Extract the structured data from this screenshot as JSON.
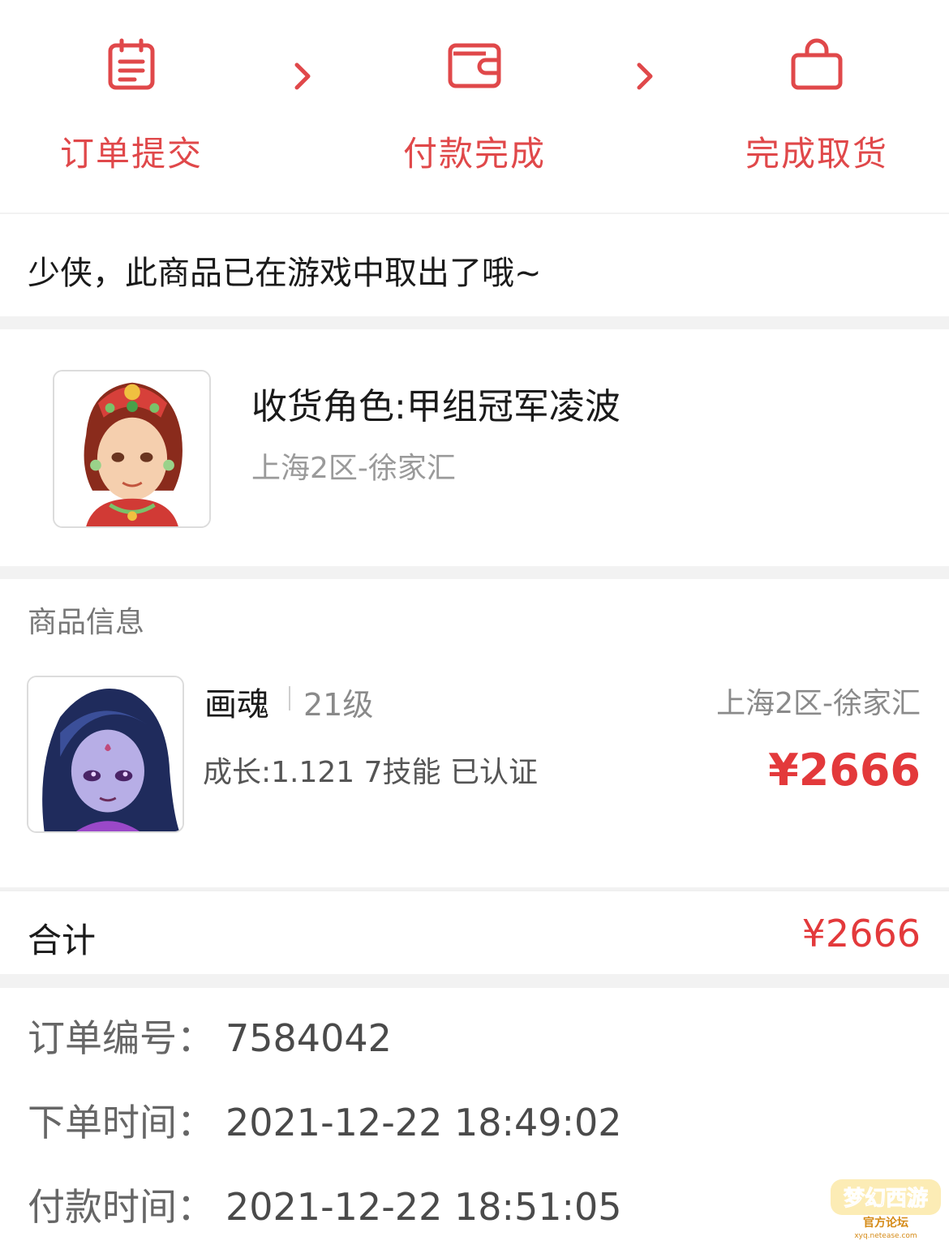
{
  "steps": [
    {
      "label": "订单提交",
      "icon": "clipboard-icon"
    },
    {
      "label": "付款完成",
      "icon": "wallet-icon"
    },
    {
      "label": "完成取货",
      "icon": "shopping-bag-icon"
    }
  ],
  "colors": {
    "accent": "#e0484a",
    "price": "#e3393b"
  },
  "notice": {
    "text": "少侠，此商品已在游戏中取出了哦~"
  },
  "receiver": {
    "name": "收货角色:甲组冠军凌波",
    "server": "上海2区-徐家汇"
  },
  "goods": {
    "section_title": "商品信息",
    "name": "画魂",
    "level": "21级",
    "server": "上海2区-徐家汇",
    "desc": "成长:1.121 7技能 已认证",
    "price": "¥2666"
  },
  "total": {
    "label": "合计",
    "value": "¥2666"
  },
  "order": {
    "number_label": "订单编号：",
    "number": "7584042",
    "created_label": "下单时间：",
    "created": "2021-12-22 18:49:02",
    "paid_label": "付款时间：",
    "paid": "2021-12-22 18:51:05"
  },
  "watermark": {
    "line1": "梦幻西游",
    "line2": "官方论坛",
    "line3": "xyq.netease.com"
  }
}
